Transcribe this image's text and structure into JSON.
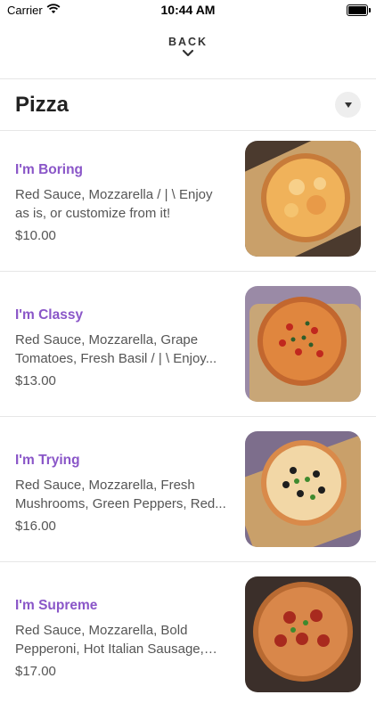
{
  "status_bar": {
    "carrier": "Carrier",
    "time": "10:44 AM"
  },
  "nav": {
    "back_label": "BACK"
  },
  "category": {
    "title": "Pizza"
  },
  "items": [
    {
      "name": "I'm Boring",
      "description": "Red Sauce, Mozzarella  / | \\  Enjoy as is, or customize from it!",
      "price": "$10.00"
    },
    {
      "name": "I'm Classy",
      "description": "Red Sauce, Mozzarella, Grape Tomatoes, Fresh Basil  / | \\  Enjoy...",
      "price": "$13.00"
    },
    {
      "name": "I'm Trying",
      "description": "Red Sauce, Mozzarella, Fresh Mushrooms, Green Peppers, Red...",
      "price": "$16.00"
    },
    {
      "name": "I'm Supreme",
      "description": "Red Sauce, Mozzarella, Bold Pepperoni, Hot Italian Sausage, Gr...",
      "price": "$17.00"
    }
  ],
  "colors": {
    "accent": "#8a56c8",
    "text": "#222222",
    "muted": "#555555",
    "divider": "#e6e6e6"
  }
}
